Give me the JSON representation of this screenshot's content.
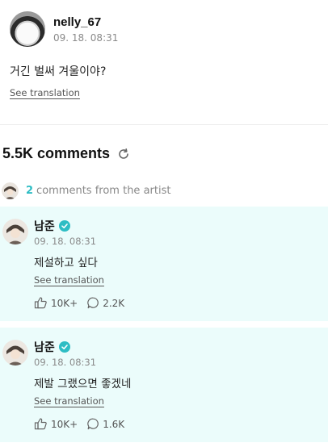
{
  "post": {
    "username": "nelly_67",
    "time": "09. 18. 08:31",
    "body": "거긴 벌써 겨울이야?",
    "translate_label": "See translation"
  },
  "comments_header": {
    "count_label": "5.5K comments",
    "refresh_icon": "refresh-icon"
  },
  "artist_filter": {
    "count": "2",
    "label": "comments from the artist"
  },
  "comments": [
    {
      "author": "남준",
      "verified": true,
      "time": "09. 18. 08:31",
      "text": "제설하고 싶다",
      "translate_label": "See translation",
      "likes": "10K+",
      "replies": "2.2K"
    },
    {
      "author": "남준",
      "verified": true,
      "time": "09. 18. 08:31",
      "text": "제발 그랬으면 좋겠네",
      "translate_label": "See translation",
      "likes": "10K+",
      "replies": "1.6K"
    }
  ],
  "colors": {
    "accent": "#2ebdc4",
    "comment_bg": "#ebfcfb"
  }
}
